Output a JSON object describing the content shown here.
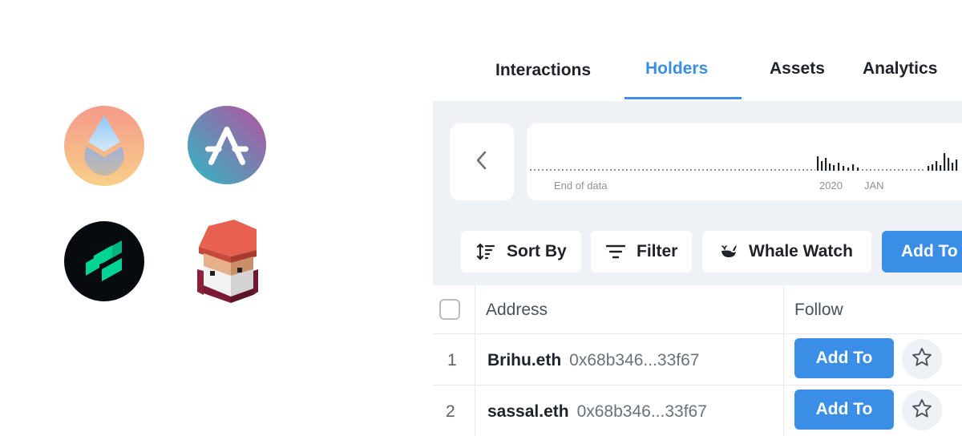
{
  "logos": [
    "lido-logo",
    "aave-logo",
    "compound-logo",
    "gnome-avatar"
  ],
  "tabs": {
    "interactions": "Interactions",
    "holders": "Holders",
    "assets": "Assets",
    "analytics": "Analytics",
    "active": "Holders"
  },
  "timeline": {
    "end_label": "End of data",
    "year_label": "2020",
    "month_label": "JAN"
  },
  "toolbar": {
    "sort_label": "Sort By",
    "filter_label": "Filter",
    "whale_label": "Whale Watch",
    "add_to_label": "Add To"
  },
  "table": {
    "columns": {
      "address": "Address",
      "follow": "Follow"
    },
    "rows": [
      {
        "index": "1",
        "name": "Brihu.eth",
        "address": "0x68b346...33f67",
        "add_label": "Add To"
      },
      {
        "index": "2",
        "name": "sassal.eth",
        "address": "0x68b346...33f67",
        "add_label": "Add To"
      }
    ]
  },
  "colors": {
    "accent": "#3b8ee5",
    "panel_bg": "#eef1f5",
    "text_dark": "#1f2329",
    "text_muted": "#8c939c"
  }
}
